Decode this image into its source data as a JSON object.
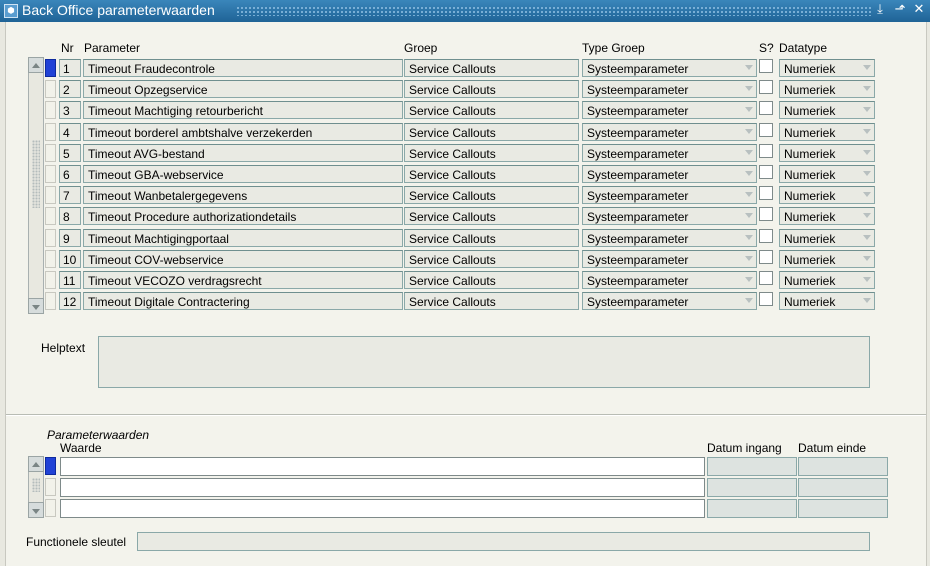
{
  "window": {
    "title": "Back Office parameterwaarden",
    "app_icon": "oracle-forms-icon",
    "controls": [
      "restore-icon",
      "maximize-icon",
      "close-icon"
    ]
  },
  "grid": {
    "headers": {
      "nr": "Nr",
      "parameter": "Parameter",
      "groep": "Groep",
      "type_groep": "Type Groep",
      "s": "S?",
      "datatype": "Datatype"
    },
    "rows": [
      {
        "nr": "1",
        "parameter": "Timeout Fraudecontrole",
        "groep": "Service Callouts",
        "type_groep": "Systeemparameter",
        "s": false,
        "datatype": "Numeriek"
      },
      {
        "nr": "2",
        "parameter": "Timeout Opzegservice",
        "groep": "Service Callouts",
        "type_groep": "Systeemparameter",
        "s": false,
        "datatype": "Numeriek"
      },
      {
        "nr": "3",
        "parameter": "Timeout Machtiging retourbericht",
        "groep": "Service Callouts",
        "type_groep": "Systeemparameter",
        "s": false,
        "datatype": "Numeriek"
      },
      {
        "nr": "4",
        "parameter": "Timeout borderel ambtshalve verzekerden",
        "groep": "Service Callouts",
        "type_groep": "Systeemparameter",
        "s": false,
        "datatype": "Numeriek"
      },
      {
        "nr": "5",
        "parameter": "Timeout AVG-bestand",
        "groep": "Service Callouts",
        "type_groep": "Systeemparameter",
        "s": false,
        "datatype": "Numeriek"
      },
      {
        "nr": "6",
        "parameter": "Timeout GBA-webservice",
        "groep": "Service Callouts",
        "type_groep": "Systeemparameter",
        "s": false,
        "datatype": "Numeriek"
      },
      {
        "nr": "7",
        "parameter": "Timeout Wanbetalergegevens",
        "groep": "Service Callouts",
        "type_groep": "Systeemparameter",
        "s": false,
        "datatype": "Numeriek"
      },
      {
        "nr": "8",
        "parameter": "Timeout Procedure authorizationdetails",
        "groep": "Service Callouts",
        "type_groep": "Systeemparameter",
        "s": false,
        "datatype": "Numeriek"
      },
      {
        "nr": "9",
        "parameter": "Timeout Machtigingportaal",
        "groep": "Service Callouts",
        "type_groep": "Systeemparameter",
        "s": false,
        "datatype": "Numeriek"
      },
      {
        "nr": "10",
        "parameter": "Timeout COV-webservice",
        "groep": "Service Callouts",
        "type_groep": "Systeemparameter",
        "s": false,
        "datatype": "Numeriek"
      },
      {
        "nr": "11",
        "parameter": "Timeout VECOZO verdragsrecht",
        "groep": "Service Callouts",
        "type_groep": "Systeemparameter",
        "s": false,
        "datatype": "Numeriek"
      },
      {
        "nr": "12",
        "parameter": "Timeout Digitale Contractering",
        "groep": "Service Callouts",
        "type_groep": "Systeemparameter",
        "s": false,
        "datatype": "Numeriek"
      }
    ]
  },
  "help": {
    "label": "Helptext",
    "value": ""
  },
  "parameterwaarden": {
    "title": "Parameterwaarden",
    "headers": {
      "waarde": "Waarde",
      "datum_ingang": "Datum ingang",
      "datum_einde": "Datum einde"
    },
    "rows": [
      {
        "waarde": "",
        "datum_ingang": "",
        "datum_einde": ""
      },
      {
        "waarde": "",
        "datum_ingang": "",
        "datum_einde": ""
      },
      {
        "waarde": "",
        "datum_ingang": "",
        "datum_einde": ""
      }
    ]
  },
  "functionele_sleutel": {
    "label": "Functionele sleutel",
    "value": ""
  },
  "colors": {
    "titlebar": "#2a73a6",
    "background": "#f3f3ec",
    "field": "#e9eae3",
    "active_record": "#2142d6"
  }
}
